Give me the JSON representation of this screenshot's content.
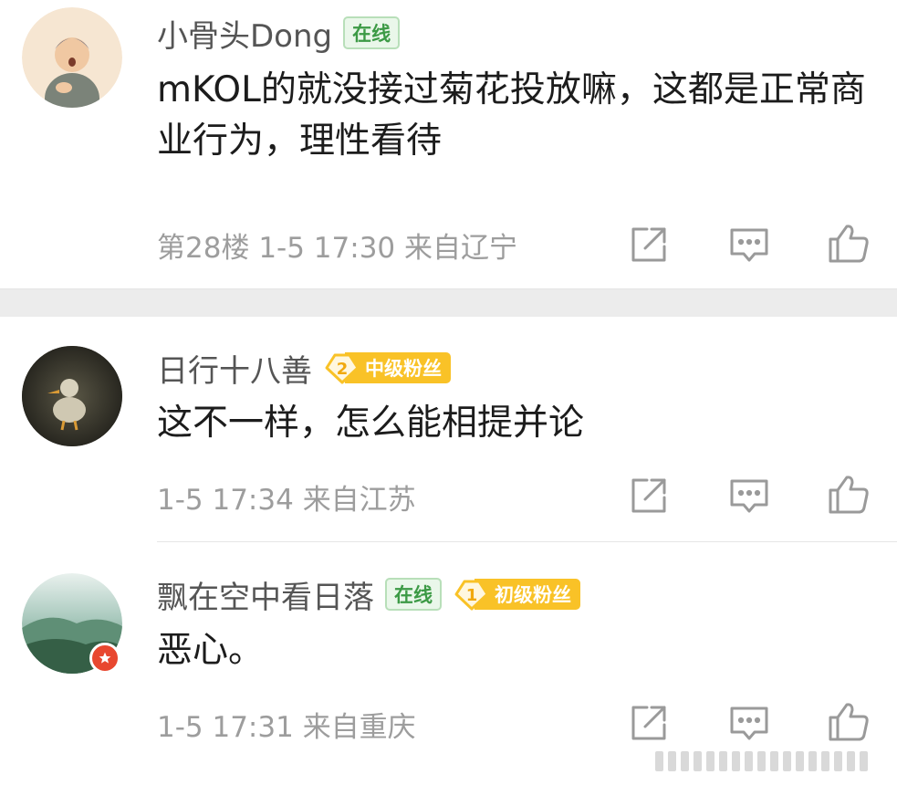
{
  "comments": [
    {
      "username": "小骨头Dong",
      "online_badge": "在线",
      "content": "mKOL的就没接过菊花投放嘛，这都是正常商业行为，理性看待",
      "floor": "第28楼",
      "time": "1-5 17:30",
      "location": "来自辽宁"
    },
    {
      "username": "日行十八善",
      "fan_level": "2",
      "fan_label": "中级粉丝",
      "content": "这不一样，怎么能相提并论",
      "time": "1-5 17:34",
      "location": "来自江苏"
    },
    {
      "username": "飘在空中看日落",
      "online_badge": "在线",
      "fan_level": "1",
      "fan_label": "初级粉丝",
      "content": "恶心。",
      "time": "1-5 17:31",
      "location": "来自重庆"
    }
  ],
  "icons": [
    "share-icon",
    "comment-icon",
    "like-icon"
  ],
  "colors": {
    "online_green": "#3c9a45",
    "fan_gold": "#f9c227",
    "meta_gray": "#9d9d9d",
    "verified_red": "#e8472f"
  }
}
